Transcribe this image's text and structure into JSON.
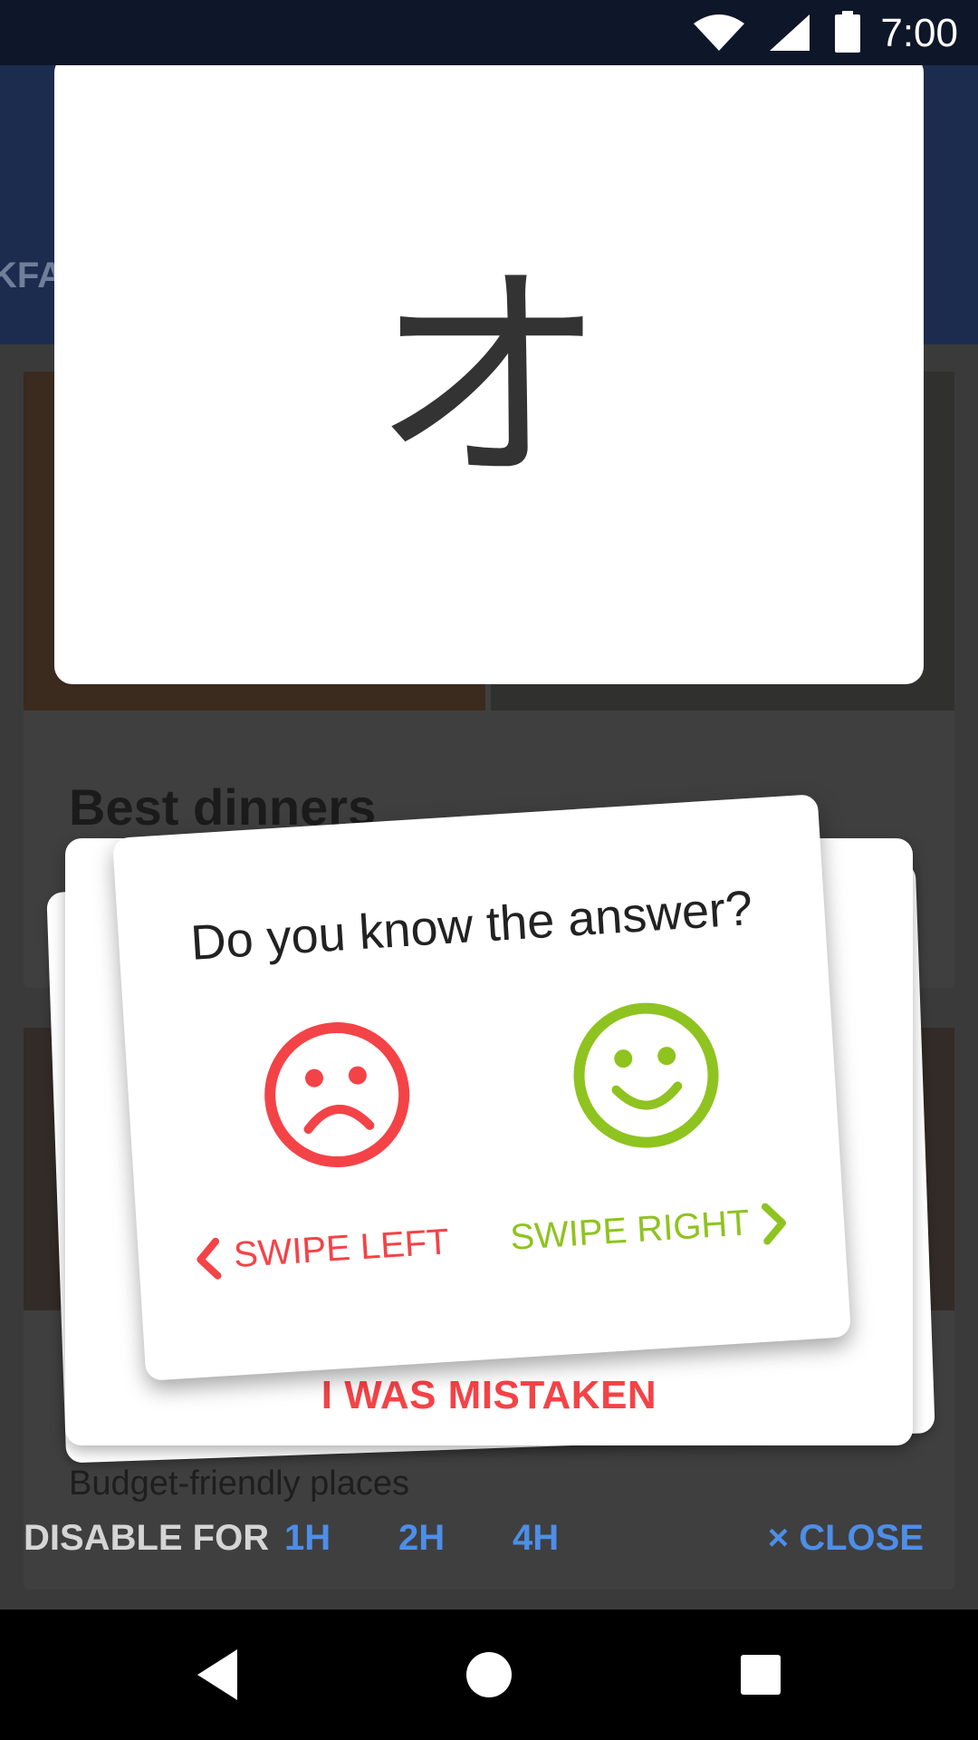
{
  "status_bar": {
    "time": "7:00",
    "icons": [
      "wifi-icon",
      "cell-signal-icon",
      "battery-icon"
    ]
  },
  "background": {
    "tab_fragment": "KFA",
    "card_title": "Best dinners",
    "card_subtitle": "Budget-friendly places"
  },
  "flashcard": {
    "character": "オ"
  },
  "tutorial": {
    "question": "Do you know the answer?",
    "swipe_left": "SWIPE LEFT",
    "swipe_right": "SWIPE RIGHT",
    "mistaken": "I WAS MISTAKEN",
    "colors": {
      "negative": "#f44347",
      "positive": "#8fc31f"
    }
  },
  "disable": {
    "label": "DISABLE FOR",
    "options": [
      "1H",
      "2H",
      "4H"
    ],
    "close_label": "× CLOSE"
  },
  "colors": {
    "accent": "#4d8ee8",
    "app_bar": "#1c2c4e"
  },
  "nav": [
    "back-icon",
    "home-icon",
    "recents-icon"
  ]
}
